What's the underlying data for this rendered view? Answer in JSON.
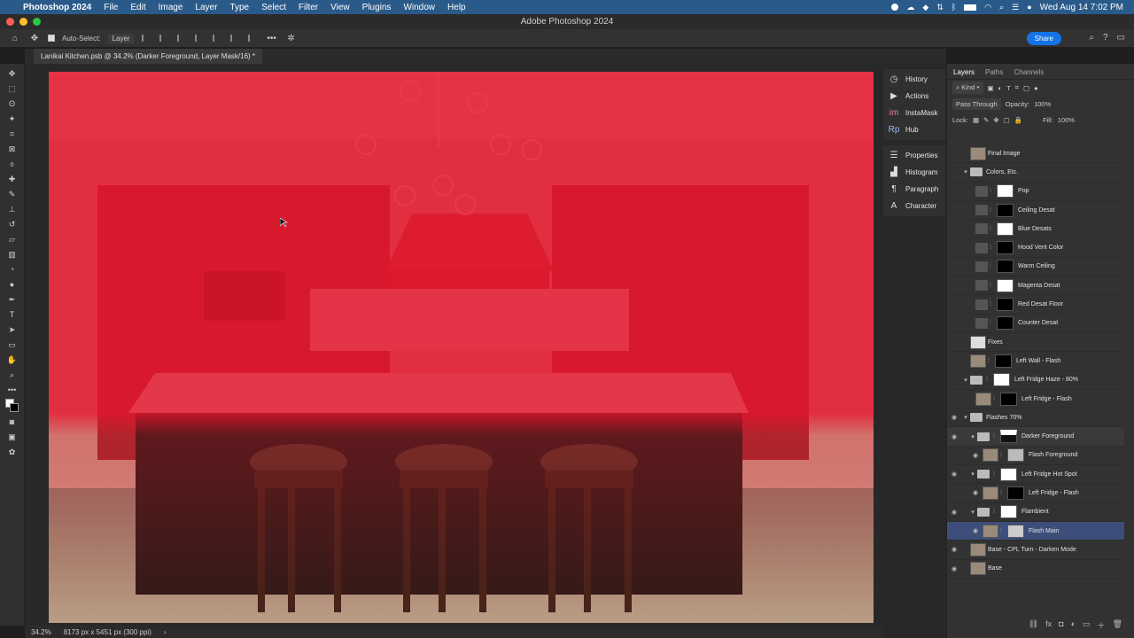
{
  "menubar": {
    "app_name": "Photoshop 2024",
    "items": [
      "File",
      "Edit",
      "Image",
      "Layer",
      "Type",
      "Select",
      "Filter",
      "View",
      "Plugins",
      "Window",
      "Help"
    ],
    "clock": "Wed Aug 14  7:02 PM"
  },
  "window": {
    "title": "Adobe Photoshop 2024"
  },
  "options": {
    "auto_select_label": "Auto-Select:",
    "auto_select_value": "Layer",
    "share_label": "Share"
  },
  "document": {
    "tab_title": "Lanikai Kitchen.psb @ 34.2% (Darker Foreground, Layer Mask/16) *"
  },
  "status": {
    "zoom": "34.2%",
    "info": "8173 px x 5451 px (300 ppi)"
  },
  "midpanel": {
    "group1": [
      "History",
      "Actions",
      "InstaMask",
      "Hub"
    ],
    "group2": [
      "Properties",
      "Histogram",
      "Paragraph",
      "Character"
    ]
  },
  "layers_panel": {
    "tabs": [
      "Layers",
      "Paths",
      "Channels"
    ],
    "kind_label": "Kind",
    "blend_mode": "Pass Through",
    "opacity_label": "Opacity:",
    "opacity_value": "100%",
    "lock_label": "Lock:",
    "fill_label": "Fill:",
    "fill_value": "100%",
    "layers": [
      {
        "name": "Final Image"
      },
      {
        "name": "Colors, Etc."
      },
      {
        "name": "Pop"
      },
      {
        "name": "Ceiling Desat"
      },
      {
        "name": "Blue Desats"
      },
      {
        "name": "Hood Vent Color"
      },
      {
        "name": "Warm Ceiling"
      },
      {
        "name": "Magenta Desat"
      },
      {
        "name": "Red Desat Floor"
      },
      {
        "name": "Counter Desat"
      },
      {
        "name": "Fixes"
      },
      {
        "name": "Left Wall - Flash"
      },
      {
        "name": "Left Fridge Haze - 80%"
      },
      {
        "name": "Left Fridge - Flash"
      },
      {
        "name": "Flashes 70%"
      },
      {
        "name": "Darker Foreground"
      },
      {
        "name": "Flash Foreground"
      },
      {
        "name": "Left Fridge Hot Spot"
      },
      {
        "name": "Left Fridge - Flash"
      },
      {
        "name": "Flambient"
      },
      {
        "name": "Flash Main"
      },
      {
        "name": "Base - CPL Turn - Darken Mode"
      },
      {
        "name": "Base"
      }
    ]
  },
  "colors": {
    "menubar": "#2a5a8a",
    "mask_overlay": "#e8142e",
    "selected_layer": "#3d4e7a",
    "share": "#1473e6"
  }
}
